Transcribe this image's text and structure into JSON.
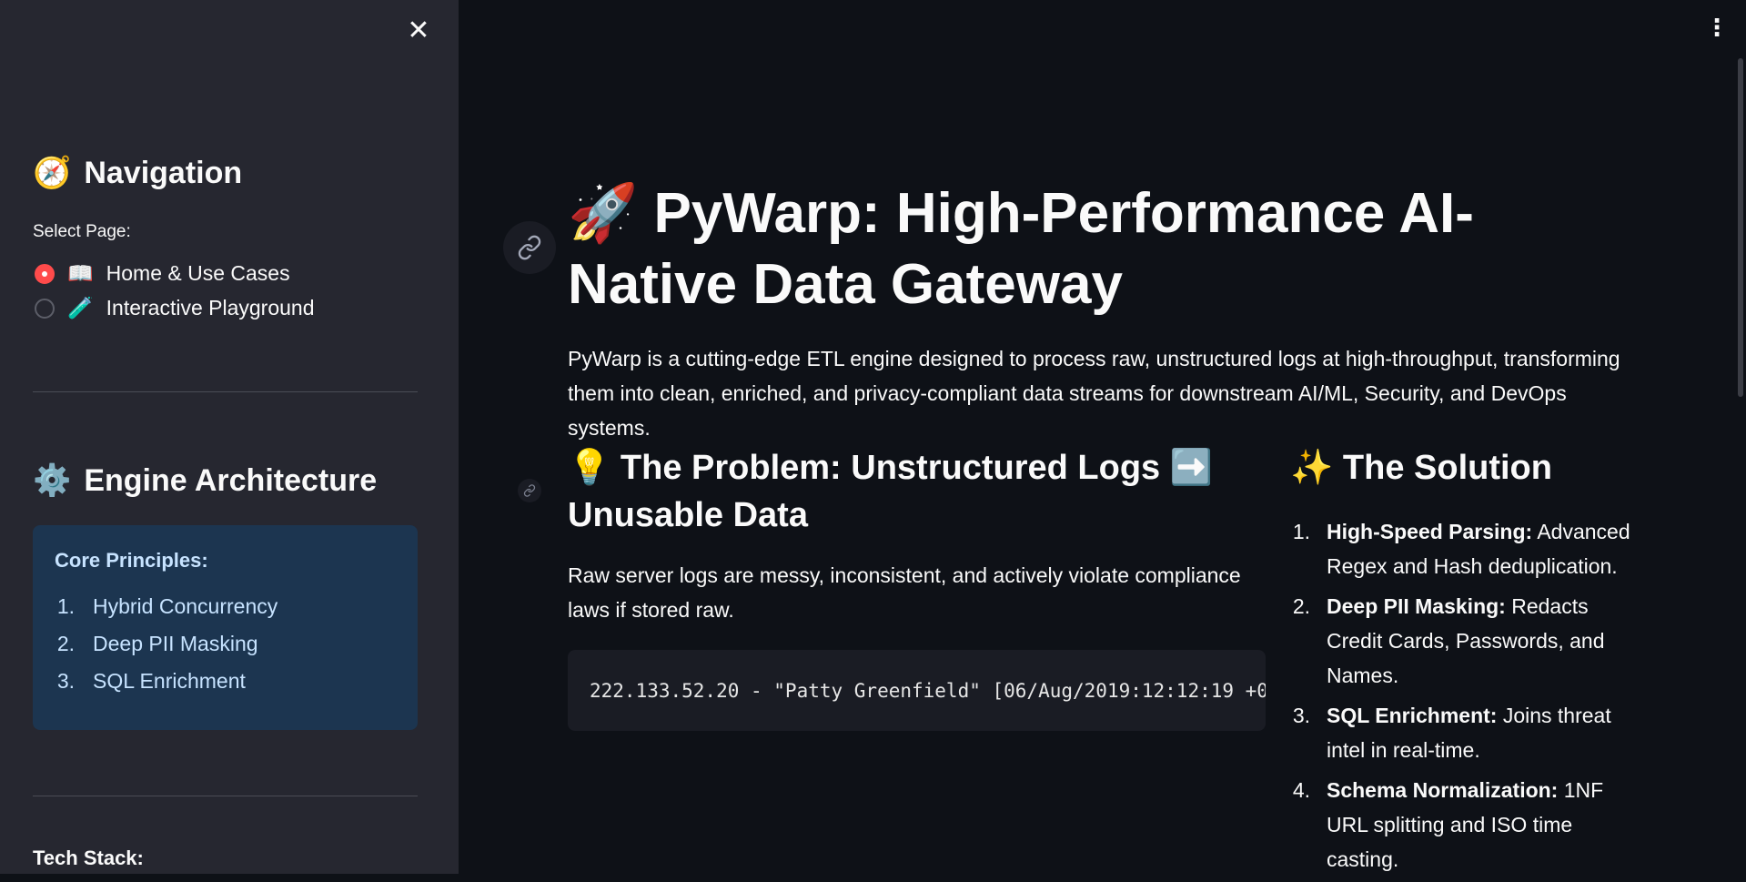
{
  "sidebar": {
    "close_glyph": "✕",
    "nav_emoji": "🧭",
    "nav_heading": "Navigation",
    "select_label": "Select Page:",
    "options": [
      {
        "emoji": "📖",
        "label": "Home & Use Cases",
        "selected": true
      },
      {
        "emoji": "🧪",
        "label": "Interactive Playground",
        "selected": false
      }
    ],
    "arch_emoji": "⚙️",
    "arch_heading": "Engine Architecture",
    "core_title": "Core Principles:",
    "principles": [
      {
        "num": "1.",
        "label": "Hybrid Concurrency"
      },
      {
        "num": "2.",
        "label": "Deep PII Masking"
      },
      {
        "num": "3.",
        "label": "SQL Enrichment"
      }
    ],
    "tech_stack_label": "Tech Stack:"
  },
  "main": {
    "menu_glyph": "⋮",
    "title_emoji": "🚀",
    "title_line1": "PyWarp: High-Performance AI-",
    "title_line2": "Native Data Gateway",
    "intro": "PyWarp is a cutting-edge ETL engine designed to process raw, unstructured logs at high-throughput, transforming them into clean, enriched, and privacy-compliant data streams for downstream AI/ML, Security, and DevOps systems.",
    "problem": {
      "emoji": "💡",
      "heading_line1": "The Problem: Unstructured Logs",
      "arrow_emoji": "➡️",
      "heading_line2": "Unusable Data",
      "text": "Raw server logs are messy, inconsistent, and actively violate compliance laws if stored raw.",
      "code": "222.133.52.20 - \"Patty Greenfield\" [06/Aug/2019:12:12:19 +0"
    },
    "solution": {
      "emoji": "✨",
      "heading": "The Solution",
      "items": [
        {
          "num": "1.",
          "bold": "High-Speed Parsing:",
          "text": " Advanced Regex and Hash deduplication."
        },
        {
          "num": "2.",
          "bold": "Deep PII Masking:",
          "text": " Redacts Credit Cards, Passwords, and Names."
        },
        {
          "num": "3.",
          "bold": "SQL Enrichment:",
          "text": " Joins threat intel in real-time."
        },
        {
          "num": "4.",
          "bold": "Schema Normalization:",
          "text": " 1NF URL splitting and ISO time casting."
        }
      ]
    }
  },
  "colors": {
    "background": "#0e1117",
    "sidebar": "#262730",
    "accent": "#ff4b4b",
    "info_box": "#1c3550"
  }
}
